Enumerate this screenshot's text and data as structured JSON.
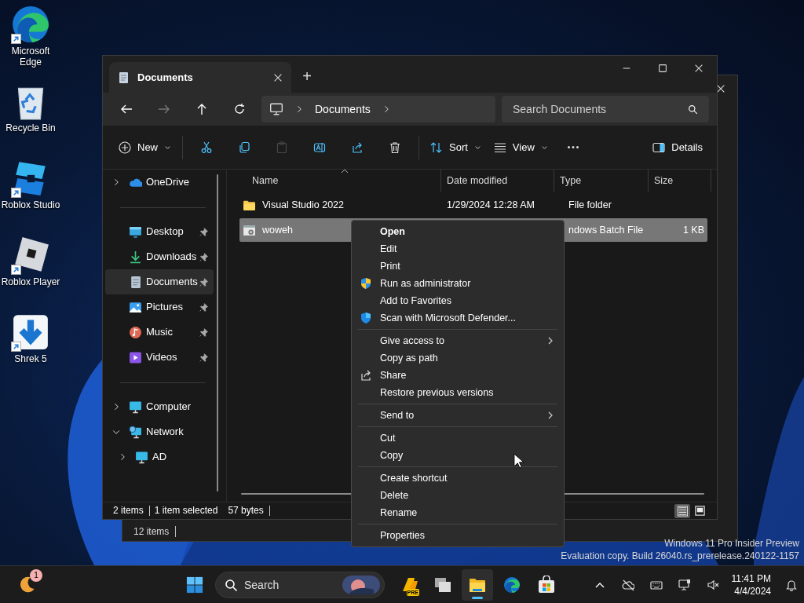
{
  "desktop_icons": [
    {
      "label": "Microsoft Edge",
      "kind": "edge",
      "shortcut": true
    },
    {
      "label": "Recycle Bin",
      "kind": "recycle",
      "shortcut": false
    },
    {
      "label": "Roblox Studio",
      "kind": "studio",
      "shortcut": true
    },
    {
      "label": "Roblox Player",
      "kind": "player",
      "shortcut": true
    },
    {
      "label": "Shrek 5",
      "kind": "download",
      "shortcut": true
    }
  ],
  "background_window": {
    "status": "12 items"
  },
  "explorer": {
    "tabs": [
      {
        "title": "Documents",
        "selected": true
      }
    ],
    "new_tab": "+",
    "nav_buttons": [
      {
        "kind": "back",
        "disabled": false
      },
      {
        "kind": "forward",
        "disabled": true
      },
      {
        "kind": "up",
        "disabled": false
      },
      {
        "kind": "refresh",
        "disabled": false
      }
    ],
    "breadcrumbs": [
      "Documents"
    ],
    "search": {
      "placeholder": "Search Documents"
    },
    "toolbar": [
      {
        "kind": "new",
        "label": "New",
        "disabled": false
      },
      {
        "kind": "separator"
      },
      {
        "kind": "cut",
        "disabled": false
      },
      {
        "kind": "copy",
        "disabled": false
      },
      {
        "kind": "paste",
        "disabled": true
      },
      {
        "kind": "rename",
        "disabled": false
      },
      {
        "kind": "share",
        "disabled": false
      },
      {
        "kind": "delete",
        "disabled": false
      },
      {
        "kind": "separator"
      },
      {
        "kind": "sort",
        "label": "Sort",
        "disabled": false
      },
      {
        "kind": "view",
        "label": "View",
        "disabled": false
      },
      {
        "kind": "more",
        "disabled": false
      },
      {
        "kind": "details",
        "label": "Details",
        "disabled": false
      }
    ],
    "sidebar": [
      [
        {
          "label": "OneDrive",
          "kind": "onedrive",
          "expanded": false,
          "pinned": false,
          "selected": false
        }
      ],
      [
        {
          "label": "Desktop",
          "kind": "desktop",
          "pinned": true,
          "selected": false
        },
        {
          "label": "Downloads",
          "kind": "downloads",
          "pinned": true,
          "selected": false
        },
        {
          "label": "Documents",
          "kind": "documents",
          "pinned": true,
          "selected": true
        },
        {
          "label": "Pictures",
          "kind": "pictures",
          "pinned": true,
          "selected": false
        },
        {
          "label": "Music",
          "kind": "music",
          "pinned": true,
          "selected": false
        },
        {
          "label": "Videos",
          "kind": "videos",
          "pinned": true,
          "selected": false
        }
      ],
      [
        {
          "label": "Computer",
          "kind": "computer",
          "expanded": false,
          "pinned": false,
          "selected": false
        },
        {
          "label": "Network",
          "kind": "network",
          "expanded": true,
          "pinned": false,
          "selected": false,
          "children": [
            {
              "label": "AD",
              "kind": "computer",
              "expanded": false,
              "pinned": false,
              "selected": false
            }
          ]
        }
      ]
    ],
    "columns": [
      {
        "label": "Name",
        "sorted": true
      },
      {
        "label": "Date modified",
        "sorted": false
      },
      {
        "label": "Type",
        "sorted": false
      },
      {
        "label": "Size",
        "sorted": false
      }
    ],
    "rows": [
      {
        "name": "Visual Studio 2022",
        "date": "1/29/2024 12:28 AM",
        "type": "File folder",
        "kind": "folder",
        "selected": false
      },
      {
        "name": "woweh",
        "type": "ndows Batch File",
        "size": "1 KB",
        "kind": "batch",
        "selected": true
      }
    ],
    "status": [
      "2 items",
      "1 item selected",
      "57 bytes"
    ],
    "view_modes": [
      {
        "kind": "details",
        "selected": true
      },
      {
        "kind": "tiles",
        "selected": false
      }
    ]
  },
  "context_menu": [
    [
      {
        "label": "Open",
        "default": true,
        "submenu": false
      },
      {
        "label": "Edit",
        "default": false,
        "submenu": false
      },
      {
        "label": "Print",
        "default": false,
        "submenu": false
      },
      {
        "label": "Run as administrator",
        "kind": "uac",
        "default": false,
        "submenu": false
      },
      {
        "label": "Add to Favorites",
        "default": false,
        "submenu": false
      },
      {
        "label": "Scan with Microsoft Defender...",
        "kind": "defender",
        "default": false,
        "submenu": false
      }
    ],
    [
      {
        "label": "Give access to",
        "default": false,
        "submenu": true
      },
      {
        "label": "Copy as path",
        "default": false,
        "submenu": false
      },
      {
        "label": "Share",
        "kind": "share",
        "default": false,
        "submenu": false
      },
      {
        "label": "Restore previous versions",
        "default": false,
        "submenu": false
      }
    ],
    [
      {
        "label": "Send to",
        "default": false,
        "submenu": true
      }
    ],
    [
      {
        "label": "Cut",
        "default": false,
        "submenu": false
      },
      {
        "label": "Copy",
        "default": false,
        "submenu": false
      }
    ],
    [
      {
        "label": "Create shortcut",
        "default": false,
        "submenu": false
      },
      {
        "label": "Delete",
        "default": false,
        "submenu": false
      },
      {
        "label": "Rename",
        "default": false,
        "submenu": false
      }
    ],
    [
      {
        "label": "Properties",
        "default": false,
        "submenu": false
      }
    ]
  ],
  "watermark": [
    "Windows 11 Pro Insider Preview",
    "Evaluation copy. Build 26040.rs_prerelease.240122-1157"
  ],
  "taskbar": {
    "weather_badge": "1",
    "search": {
      "placeholder": "Search"
    },
    "apps": [
      {
        "kind": "copilot",
        "badge": "PRE",
        "selected": false
      },
      {
        "kind": "taskview",
        "selected": false
      },
      {
        "kind": "explorer",
        "selected": true
      },
      {
        "kind": "edge",
        "selected": false
      },
      {
        "kind": "store",
        "selected": false
      }
    ],
    "tray": [
      {
        "kind": "chevron"
      },
      {
        "kind": "cloud-off"
      },
      {
        "kind": "keyboard"
      },
      {
        "kind": "display"
      },
      {
        "kind": "mute"
      }
    ],
    "clock": {
      "time": "11:41 PM",
      "date": "4/4/2024"
    }
  }
}
